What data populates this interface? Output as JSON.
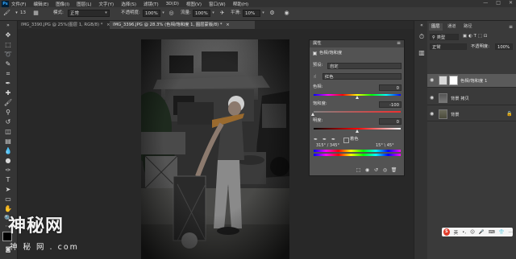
{
  "menu": {
    "logo": "Ps",
    "items": [
      "文件(F)",
      "编辑(E)",
      "图像(I)",
      "图层(L)",
      "文字(Y)",
      "选择(S)",
      "滤镜(T)",
      "3D(D)",
      "视图(V)",
      "窗口(W)",
      "帮助(H)"
    ],
    "window_controls": [
      "—",
      "□",
      "✕"
    ]
  },
  "options": {
    "mode_label": "模式:",
    "mode_value": "正常",
    "opacity_label": "不透明度:",
    "opacity_value": "100%",
    "flow_label": "流量:",
    "flow_value": "100%",
    "smooth_label": "平滑:",
    "smooth_value": "10%",
    "brush_size": "13"
  },
  "tabs": [
    {
      "label": "IMG_3390.JPG @ 25%(图层 1, RGB/8) *",
      "close": "×"
    },
    {
      "label": "IMG_3396.JPG @ 28.3% (色相/饱和度 1, 图层蒙版/8) *",
      "close": "×"
    }
  ],
  "properties": {
    "title": "属性",
    "header_label": "色相/饱和度",
    "preset_label": "预设:",
    "preset_value": "自定",
    "channel_value": "红色",
    "hue_label": "色相:",
    "hue_value": "0",
    "saturation_label": "饱和度:",
    "saturation_value": "-100",
    "saturation_level": -100,
    "lightness_label": "明度:",
    "lightness_value": "0",
    "colorize_label": "着色",
    "range_left": "315° / 345°",
    "range_right": "15° \\ 45°"
  },
  "layers_panel": {
    "tabs": [
      "图层",
      "通道",
      "路径"
    ],
    "filter_label": "类型",
    "blend_mode": "正常",
    "opacity_label": "不透明度:",
    "opacity_value": "100%",
    "layers": [
      {
        "name": "色相/饱和度 1",
        "visible": true
      },
      {
        "name": "背景 拷贝",
        "visible": true
      },
      {
        "name": "背景",
        "visible": true
      }
    ]
  },
  "ime": {
    "label": "英",
    "icons": [
      "•,",
      "☺",
      "🎤",
      "⌨",
      "👕",
      "⋯"
    ]
  },
  "watermark": {
    "line1": "神秘网",
    "line2": "神 秘 网 . com"
  },
  "colors": {
    "fg": "#000000",
    "bg": "#ffffff",
    "ps_blue": "#31a8ff"
  }
}
